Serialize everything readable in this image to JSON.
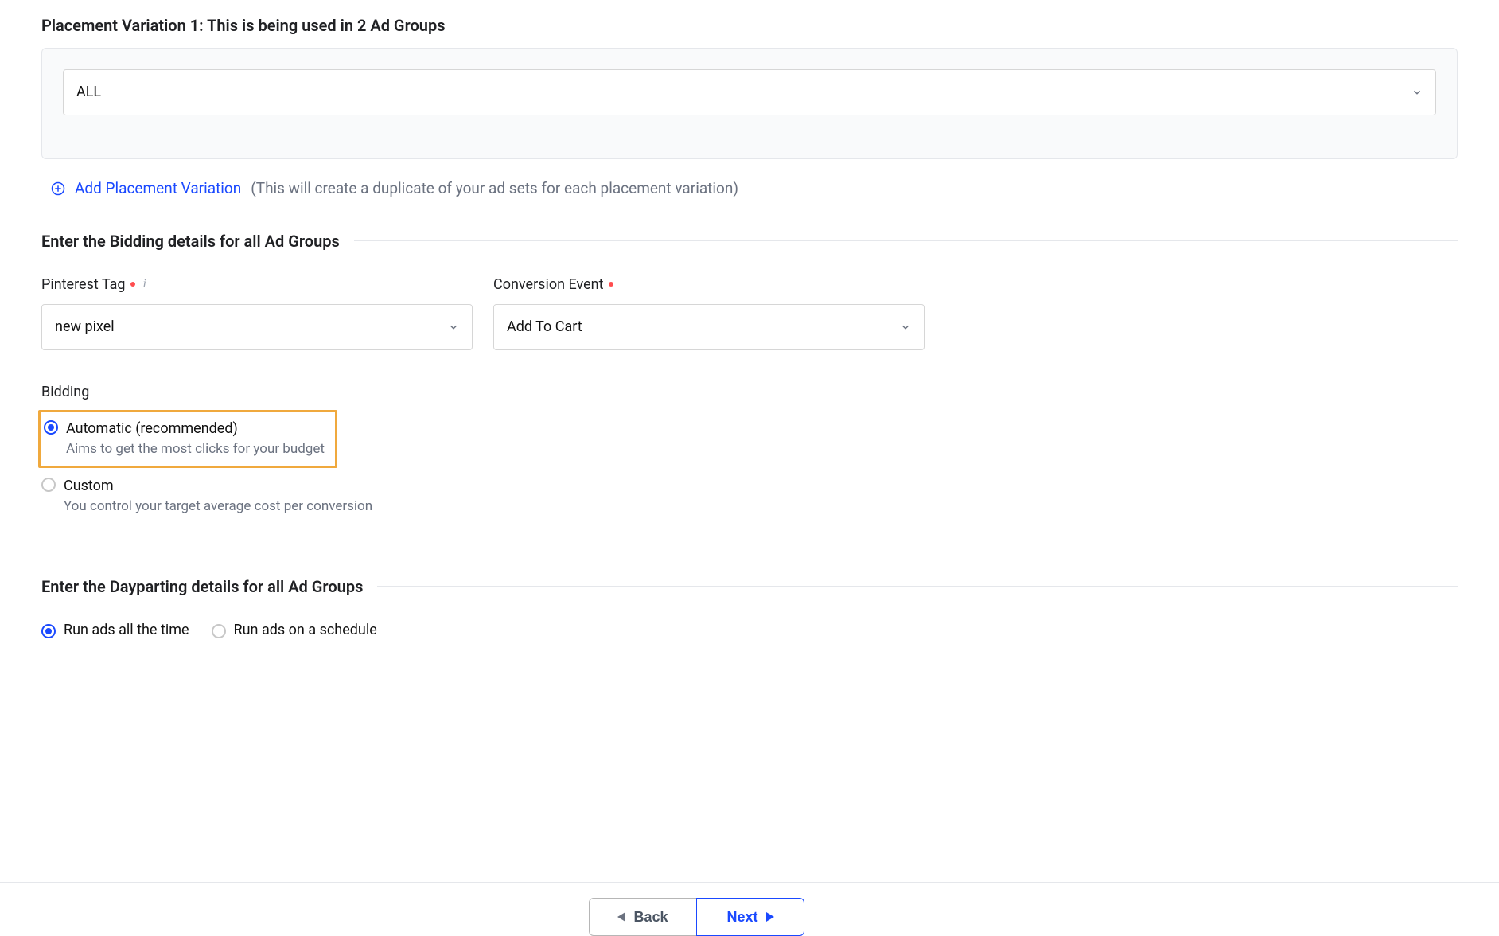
{
  "placement": {
    "title": "Placement Variation 1: This is being used in 2 Ad Groups",
    "select_value": "ALL"
  },
  "add_variation": {
    "link": "Add Placement Variation",
    "hint": "(This will create a duplicate of your ad sets for each placement variation)"
  },
  "bidding_section": {
    "heading": "Enter the Bidding details for all Ad Groups",
    "pinterest_tag_label": "Pinterest Tag",
    "pinterest_tag_value": "new pixel",
    "conversion_event_label": "Conversion Event",
    "conversion_event_value": "Add To Cart",
    "bidding_label": "Bidding",
    "automatic_label": "Automatic (recommended)",
    "automatic_desc": "Aims to get the most clicks for your budget",
    "custom_label": "Custom",
    "custom_desc": "You control your target average cost per conversion"
  },
  "dayparting_section": {
    "heading": "Enter the Dayparting details for all Ad Groups",
    "run_all_label": "Run ads all the time",
    "run_schedule_label": "Run ads on a schedule"
  },
  "footer": {
    "back": "Back",
    "next": "Next"
  }
}
